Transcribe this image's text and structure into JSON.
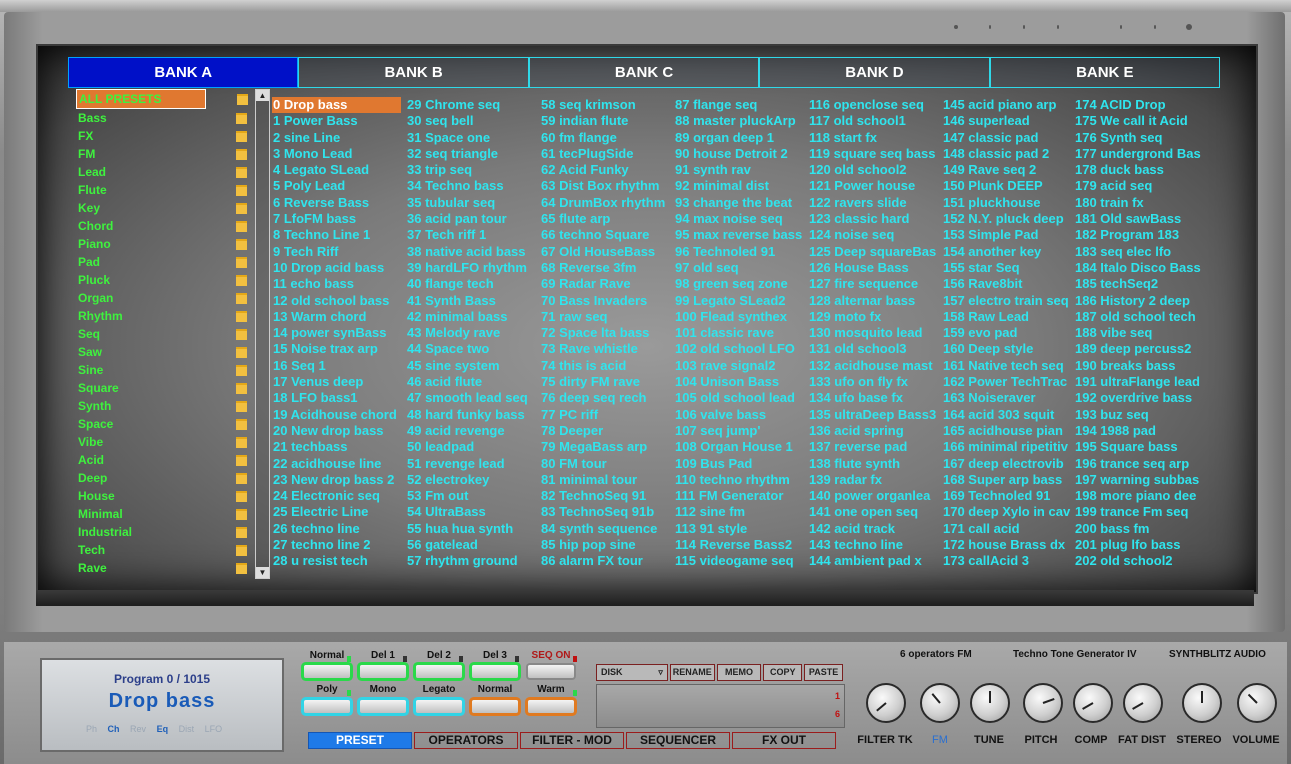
{
  "banks": [
    "BANK A",
    "BANK B",
    "BANK C",
    "BANK D",
    "BANK E"
  ],
  "categories": [
    "ALL PRESETS",
    "Bass",
    "FX",
    "FM",
    "Lead",
    "Flute",
    "Key",
    "Chord",
    "Piano",
    "Pad",
    "Pluck",
    "Organ",
    "Rhythm",
    "Seq",
    "Saw",
    "Sine",
    "Square",
    "Synth",
    "Space",
    "Vibe",
    "Acid",
    "Deep",
    "House",
    "Minimal",
    "Industrial",
    "Tech",
    "Rave"
  ],
  "preset_columns": [
    [
      "0 Drop bass",
      "1 Power Bass",
      "2 sine Line",
      "3 Mono Lead",
      "4 Legato SLead",
      "5 Poly Lead",
      "6 Reverse Bass",
      "7 LfoFM bass",
      "8 Techno Line 1",
      "9 Tech Riff",
      "10 Drop acid bass",
      "11 echo bass",
      "12 old school bass",
      "13 Warm chord",
      "14 power synBass",
      "15 Noise trax arp",
      "16 Seq 1",
      "17 Venus deep",
      "18 LFO bass1",
      "19 Acidhouse chord",
      "20 New drop bass",
      "21 techbass",
      "22 acidhouse line",
      "23 New drop bass 2",
      "24 Electronic seq",
      "25 Electric Line",
      "26 techno line",
      "27 techno line 2",
      "28 u resist tech"
    ],
    [
      "29 Chrome  seq",
      "30 seq bell",
      "31 Space one",
      "32 seq triangle",
      "33 trip seq",
      "34 Techno bass",
      "35 tubular seq",
      "36 acid pan tour",
      "37 Tech riff 1",
      "38 native acid bass",
      "39 hardLFO rhythm",
      "40 flange tech",
      "41 Synth Bass",
      "42 minimal bass",
      "43 Melody rave",
      "44 Space two",
      "45 sine system",
      "46 acid flute",
      "47 smooth lead seq",
      "48 hard funky bass",
      "49 acid revenge",
      "50 leadpad",
      "51 revenge lead",
      "52 electrokey",
      "53 Fm out",
      "54 UltraBass",
      "55 hua hua synth",
      "56 gatelead",
      "57 rhythm ground"
    ],
    [
      "58 seq krimson",
      "59 indian flute",
      "60 fm flange",
      "61 tecPlugSide",
      "62 Acid Funky",
      "63 Dist Box rhythm",
      "64 DrumBox rhythm",
      "65 flute arp",
      "66 techno Square",
      "67 Old HouseBass",
      "68 Reverse 3fm",
      "69 Radar Rave",
      "70 Bass Invaders",
      "71 raw seq",
      "72 Space lta bass",
      "73 Rave whistle",
      "74 this is acid",
      "75 dirty FM rave",
      "76 deep seq rech",
      "77 PC riff",
      "78 Deeper",
      "79 MegaBass arp",
      "80 FM tour",
      "81 minimal tour",
      "82 TechnoSeq 91",
      "83 TechnoSeq 91b",
      "84 synth sequence",
      "85 hip pop sine",
      "86 alarm FX tour"
    ],
    [
      "87 flange seq",
      "88 master pluckArp",
      "89 organ deep 1",
      "90 house Detroit 2",
      "91 synth rav",
      "92 minimal dist",
      "93 change the beat",
      "94 max noise seq",
      "95 max reverse bass",
      "96 Technoled 91",
      "97 old seq",
      "98 green seq zone",
      "99 Legato SLead2",
      "100 Flead synthex",
      "101 classic rave",
      "102 old school LFO",
      "103 rave signal2",
      "104 Unison Bass",
      "105 old school lead",
      "106 valve bass",
      "107 seq jump'",
      "108 Organ House 1",
      "109 Bus Pad",
      "110 techno rhythm",
      "111 FM Generator",
      "112 sine fm",
      "113 91 style",
      "114 Reverse Bass2",
      "115 videogame seq"
    ],
    [
      "116 openclose seq",
      "117 old school1",
      "118 start fx",
      "119 square seq bass",
      "120 old school2",
      "121 Power house",
      "122 ravers slide",
      "123 classic hard",
      "124 noise seq",
      "125 Deep squareBas",
      "126 House Bass",
      "127 fire sequence",
      "128 alternar bass",
      "129 moto fx",
      "130 mosquito lead",
      "131 old school3",
      "132 acidhouse mast",
      "133 ufo on fly fx",
      "134 ufo base fx",
      "135 ultraDeep Bass3",
      "136 acid spring",
      "137 reverse pad",
      "138 flute synth",
      "139 radar fx",
      "140 power organlea",
      "141 one open seq",
      "142 acid track",
      "143 techno line",
      "144 ambient pad x"
    ],
    [
      "145 acid piano arp",
      "146 superlead",
      "147 classic pad",
      "148 classic pad 2",
      "149 Rave seq 2",
      "150 Plunk DEEP",
      "151 pluckhouse",
      "152 N.Y. pluck deep",
      "153 Simple Pad",
      "154 another key",
      "155 star Seq",
      "156 Rave8bit",
      "157 electro train seq",
      "158 Raw Lead",
      "159 evo pad",
      "160 Deep style",
      "161 Native tech seq",
      "162 Power TechTrac",
      "163 Noiseraver",
      "164 acid 303 squit",
      "165 acidhouse pian",
      "166 minimal ripetitiv",
      "167 deep electrovib",
      "168 Super arp bass",
      "169 Technoled 91",
      "170 deep Xylo in cav",
      "171 call acid",
      "172 house Brass dx",
      "173 callAcid 3"
    ],
    [
      "174 ACID Drop",
      "175 We call it Acid",
      "176 Synth seq",
      "177 undergrond Bas",
      "178 duck bass",
      "179 acid seq",
      "180 train fx",
      "181 Old sawBass",
      "182 Program 183",
      "183 seq elec lfo",
      "184 Italo Disco Bass",
      "185 techSeq2",
      "186 History 2 deep",
      "187 old school tech",
      "188 vibe seq",
      "189 deep percuss2",
      "190 breaks bass",
      "191 ultraFlange lead",
      "192 overdrive bass",
      "193 buz seq",
      "194 1988 pad",
      "195 Square bass",
      "196 trance seq arp",
      "197 warning subbas",
      "198 more piano dee",
      "199 trance Fm seq",
      "200 bass fm",
      "201 plug lfo bass",
      "202 old school2"
    ]
  ],
  "lcd": {
    "program": "Program  0  /  1015",
    "name": "Drop  bass",
    "modes": [
      "Ph",
      "Ch",
      "Rev",
      "Eq",
      "Dist",
      "LFO"
    ]
  },
  "fx_switches": {
    "row1": [
      "Normal",
      "Del 1",
      "Del 2",
      "Del 3",
      "SEQ ON"
    ],
    "row2": [
      "Poly",
      "Mono",
      "Legato",
      "Normal",
      "Warm"
    ]
  },
  "disk": {
    "select": "DISK",
    "buttons": [
      "RENAME",
      "MEMO",
      "COPY",
      "PASTE"
    ],
    "display_digits": [
      "1",
      "6"
    ]
  },
  "nav_tabs": [
    "PRESET",
    "OPERATORS",
    "FILTER - MOD",
    "SEQUENCER",
    "FX OUT"
  ],
  "header": {
    "ops": "6  operators  FM",
    "product": "Techno  Tone  Generator  IV",
    "brand": "SYNTHBLITZ  AUDIO"
  },
  "knobs": [
    "FILTER TK",
    "FM",
    "TUNE",
    "PITCH",
    "COMP",
    "FAT DIST",
    "STEREO",
    "VOLUME"
  ],
  "colors": {
    "preset_text": "#2fe5ee",
    "category_text": "#3ef23e",
    "selection": "#e07830",
    "active_bank": "#0010c8",
    "active_nav": "#1e7ae8"
  }
}
